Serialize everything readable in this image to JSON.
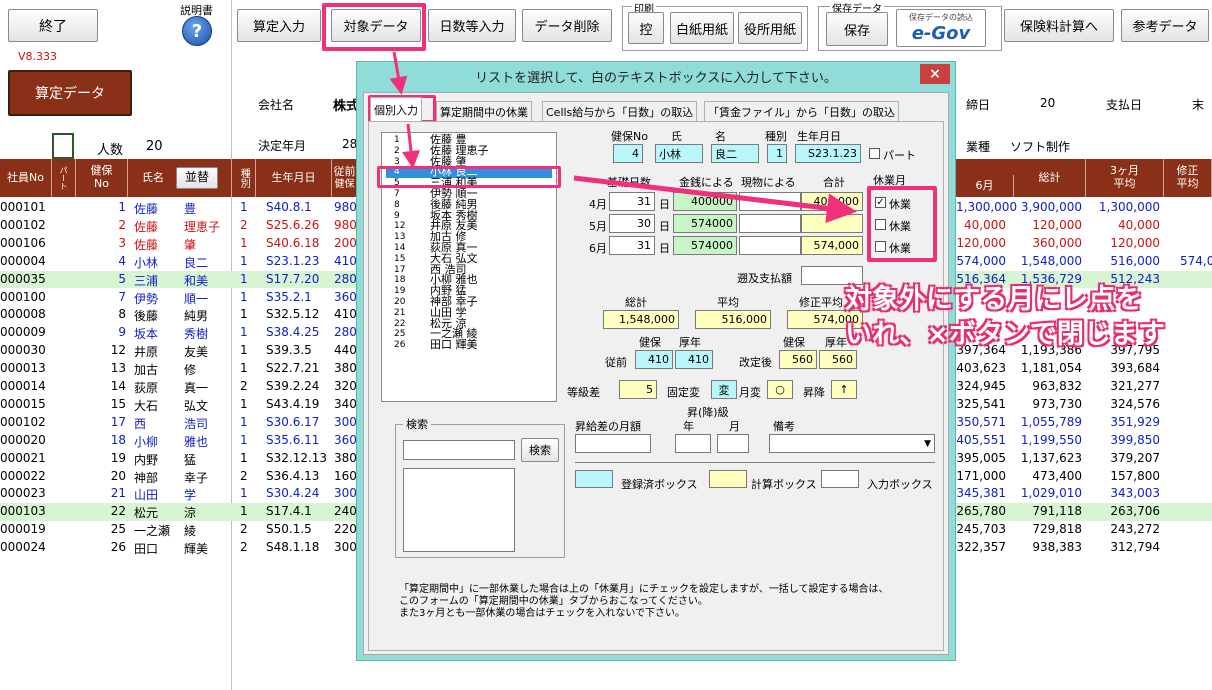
{
  "toolbar": {
    "exit": "終了",
    "manual_label": "説明書",
    "version": "V8.333",
    "santei_data": "算定データ",
    "santei_input": "算定入力",
    "target_data": "対象データ",
    "days_input": "日数等入力",
    "data_delete": "データ削除",
    "print_group": "印刷",
    "print_ctrl": "控",
    "print_blank": "白紙用紙",
    "print_office": "役所用紙",
    "save_group": "保存データ",
    "save": "保存",
    "egov_caption": "保存データの読込",
    "egov": "e-Gov",
    "insurance_calc": "保険料計算へ",
    "reference_data": "参考データ"
  },
  "info": {
    "company_label": "会社名",
    "company_value": "株式",
    "decision_label": "決定年月",
    "decision_value": "28",
    "people_label": "人数",
    "people_value": "20",
    "closing_label": "締日",
    "closing_value": "20",
    "payday_label": "支払日",
    "payday_value": "末",
    "industry_label": "業種",
    "industry_value": "ソフト制作"
  },
  "grid": {
    "headers": {
      "emp_no": "社員No",
      "part": "パート",
      "kenpo_no": "健保\nNo",
      "name": "氏名",
      "sort_button": "並替",
      "type": "種別",
      "birth": "生年月日",
      "former": "従前",
      "former_sub": "健保",
      "june": "6月",
      "total": "総計",
      "three_month_avg": "3ヶ月\n平均",
      "revised_avg": "修正\n平均"
    },
    "rows": [
      {
        "emp": "000101",
        "no": "1",
        "last": "佐藤",
        "first": "豊",
        "type": "1",
        "birth": "S40.8.1",
        "prev": "980",
        "june": "1,300,000",
        "total": "3,900,000",
        "avg": "1,300,000",
        "extra": "",
        "color": "blue",
        "green": false
      },
      {
        "emp": "000102",
        "no": "2",
        "last": "佐藤",
        "first": "理恵子",
        "type": "2",
        "birth": "S25.6.26",
        "prev": "980",
        "june": "40,000",
        "total": "120,000",
        "avg": "40,000",
        "extra": "",
        "color": "red",
        "green": false
      },
      {
        "emp": "000106",
        "no": "3",
        "last": "佐藤",
        "first": "肇",
        "type": "1",
        "birth": "S40.6.18",
        "prev": "200",
        "june": "120,000",
        "total": "360,000",
        "avg": "120,000",
        "extra": "",
        "color": "red",
        "green": false
      },
      {
        "emp": "000004",
        "no": "4",
        "last": "小林",
        "first": "良二",
        "type": "1",
        "birth": "S23.1.23",
        "prev": "410",
        "june": "574,000",
        "total": "1,548,000",
        "avg": "516,000",
        "extra": "574,0",
        "color": "blue",
        "green": false
      },
      {
        "emp": "000035",
        "no": "5",
        "last": "三浦",
        "first": "和美",
        "type": "1",
        "birth": "S17.7.20",
        "prev": "280",
        "june": "516,364",
        "total": "1,536,729",
        "avg": "512,243",
        "extra": "",
        "color": "blue",
        "green": true
      },
      {
        "emp": "000100",
        "no": "7",
        "last": "伊勢",
        "first": "順一",
        "type": "1",
        "birth": "S35.2.1",
        "prev": "360",
        "june": "",
        "total": "",
        "avg": "",
        "extra": "",
        "color": "blue",
        "green": false
      },
      {
        "emp": "000008",
        "no": "8",
        "last": "後藤",
        "first": "純男",
        "type": "1",
        "birth": "S32.5.12",
        "prev": "410",
        "june": "",
        "total": "",
        "avg": "",
        "extra": "",
        "color": "blk",
        "green": false
      },
      {
        "emp": "000009",
        "no": "9",
        "last": "坂本",
        "first": "秀樹",
        "type": "1",
        "birth": "S38.4.25",
        "prev": "280",
        "june": "",
        "total": "",
        "avg": "",
        "extra": "",
        "color": "blue",
        "green": false
      },
      {
        "emp": "000030",
        "no": "12",
        "last": "井原",
        "first": "友美",
        "type": "1",
        "birth": "S39.3.5",
        "prev": "440",
        "june": "397,364",
        "total": "1,193,386",
        "avg": "397,795",
        "extra": "",
        "color": "blk",
        "green": false
      },
      {
        "emp": "000013",
        "no": "13",
        "last": "加古",
        "first": "修",
        "type": "1",
        "birth": "S22.7.21",
        "prev": "380",
        "june": "403,623",
        "total": "1,181,054",
        "avg": "393,684",
        "extra": "",
        "color": "blk",
        "green": false
      },
      {
        "emp": "000014",
        "no": "14",
        "last": "荻原",
        "first": "真一",
        "type": "2",
        "birth": "S39.2.24",
        "prev": "320",
        "june": "324,945",
        "total": "963,832",
        "avg": "321,277",
        "extra": "",
        "color": "blk",
        "green": false
      },
      {
        "emp": "000015",
        "no": "15",
        "last": "大石",
        "first": "弘文",
        "type": "1",
        "birth": "S43.4.19",
        "prev": "340",
        "june": "325,541",
        "total": "973,730",
        "avg": "324,576",
        "extra": "",
        "color": "blk",
        "green": false
      },
      {
        "emp": "000102",
        "no": "17",
        "last": "西",
        "first": "浩司",
        "type": "1",
        "birth": "S30.6.17",
        "prev": "300",
        "june": "350,571",
        "total": "1,055,789",
        "avg": "351,929",
        "extra": "",
        "color": "blue",
        "green": false
      },
      {
        "emp": "000020",
        "no": "18",
        "last": "小柳",
        "first": "雅也",
        "type": "1",
        "birth": "S35.6.11",
        "prev": "360",
        "june": "405,551",
        "total": "1,199,550",
        "avg": "399,850",
        "extra": "",
        "color": "blue",
        "green": false
      },
      {
        "emp": "000021",
        "no": "19",
        "last": "内野",
        "first": "猛",
        "type": "1",
        "birth": "S32.12.13",
        "prev": "380",
        "june": "395,005",
        "total": "1,137,623",
        "avg": "379,207",
        "extra": "",
        "color": "blk",
        "green": false
      },
      {
        "emp": "000022",
        "no": "20",
        "last": "神部",
        "first": "幸子",
        "type": "2",
        "birth": "S36.4.13",
        "prev": "160",
        "june": "171,000",
        "total": "473,400",
        "avg": "157,800",
        "extra": "",
        "color": "blk",
        "green": false
      },
      {
        "emp": "000023",
        "no": "21",
        "last": "山田",
        "first": "学",
        "type": "1",
        "birth": "S30.4.24",
        "prev": "300",
        "june": "345,381",
        "total": "1,029,010",
        "avg": "343,003",
        "extra": "",
        "color": "blue",
        "green": false
      },
      {
        "emp": "000103",
        "no": "22",
        "last": "松元",
        "first": "涼",
        "type": "1",
        "birth": "S17.4.1",
        "prev": "240",
        "june": "265,780",
        "total": "791,118",
        "avg": "263,706",
        "extra": "",
        "color": "blk",
        "green": true
      },
      {
        "emp": "000019",
        "no": "25",
        "last": "一之瀬",
        "first": "綾",
        "type": "2",
        "birth": "S50.1.5",
        "prev": "220",
        "june": "245,703",
        "total": "729,818",
        "avg": "243,272",
        "extra": "",
        "color": "blk",
        "green": false
      },
      {
        "emp": "000024",
        "no": "26",
        "last": "田口",
        "first": "輝美",
        "type": "2",
        "birth": "S48.1.18",
        "prev": "300",
        "june": "322,357",
        "total": "938,383",
        "avg": "312,794",
        "extra": "",
        "color": "blk",
        "green": false
      }
    ]
  },
  "dialog": {
    "title": "リストを選択して、白のテキストボックスに入力して下さい。",
    "close": "×",
    "tabs": [
      "個別入力",
      "算定期間中の休業",
      "Cells給与から「日数」の取込",
      "「賃金ファイル」から「日数」の取込"
    ],
    "list": [
      {
        "n": "1",
        "t": "佐藤 豊"
      },
      {
        "n": "2",
        "t": "佐藤 理恵子"
      },
      {
        "n": "3",
        "t": "佐藤 肇"
      },
      {
        "n": "4",
        "t": "小林 良二"
      },
      {
        "n": "5",
        "t": "三浦 和美"
      },
      {
        "n": "7",
        "t": "伊勢 順一"
      },
      {
        "n": "8",
        "t": "後藤 純男"
      },
      {
        "n": "9",
        "t": "坂本 秀樹"
      },
      {
        "n": "12",
        "t": "井原 友美"
      },
      {
        "n": "13",
        "t": "加古 修"
      },
      {
        "n": "14",
        "t": "荻原 真一"
      },
      {
        "n": "15",
        "t": "大石 弘文"
      },
      {
        "n": "17",
        "t": "西 浩司"
      },
      {
        "n": "18",
        "t": "小柳 雅也"
      },
      {
        "n": "19",
        "t": "内野 猛"
      },
      {
        "n": "20",
        "t": "神部 幸子"
      },
      {
        "n": "21",
        "t": "山田 学"
      },
      {
        "n": "22",
        "t": "松元 涼"
      },
      {
        "n": "25",
        "t": "一之瀬 綾"
      },
      {
        "n": "26",
        "t": "田口 輝美"
      }
    ],
    "labels": {
      "kenpo_no": "健保No",
      "last": "氏",
      "first": "名",
      "type": "種別",
      "birth": "生年月日",
      "part": "パート",
      "base_days": "基礎日数",
      "cash": "金銭による",
      "goods": "現物による",
      "sum": "合計",
      "april": "4月",
      "may": "5月",
      "june": "6月",
      "day": "日",
      "leave_month": "休業月",
      "leave": "休業",
      "retro": "遡及支払額",
      "total": "総計",
      "average": "平均",
      "revised_average": "修正平均",
      "kenpo": "健保",
      "kosei": "厚年",
      "former": "従前",
      "after": "改定後",
      "grade_diff": "等級差",
      "fixed_change": "固定変",
      "month_change": "月変",
      "up_down": "昇降",
      "search_group": "検索",
      "search_button": "検索",
      "raise_amount": "昇給差の月額",
      "raise_grade": "昇(降)級",
      "year": "年",
      "month": "月",
      "remarks": "備考",
      "registered_box": "登録済ボックス",
      "calc_box": "計算ボックス",
      "input_box": "入力ボックス",
      "note1": "「算定期間中」に一部休業した場合は上の「休業月」にチェックを設定しますが、一括して設定する場合は、",
      "note2": "このフォームの「算定期間中の休業」タブからおこなってください。",
      "note3": "また3ヶ月とも一部休業の場合はチェックを入れないで下さい。"
    },
    "values": {
      "kenpo_no": "4",
      "last": "小林",
      "first": "良二",
      "type": "1",
      "birth": "S23.1.23",
      "days_apr": "31",
      "days_may": "30",
      "days_jun": "31",
      "cash_apr": "400000",
      "cash_may": "574000",
      "cash_jun": "574000",
      "sum_apr": "400,000",
      "sum_may": "",
      "sum_jun": "574,000",
      "total": "1,548,000",
      "average": "516,000",
      "revised_average": "574,000",
      "former_kenpo": "410",
      "former_kosei": "410",
      "after_kenpo": "560",
      "after_kosei": "560",
      "grade_diff": "5",
      "fixed_change": "変",
      "month_change": "○",
      "up_down": "↑"
    }
  },
  "annotation": {
    "line1": "対象外にする月にレ点を",
    "line2": "いれ、×ボタンで閉じます"
  }
}
